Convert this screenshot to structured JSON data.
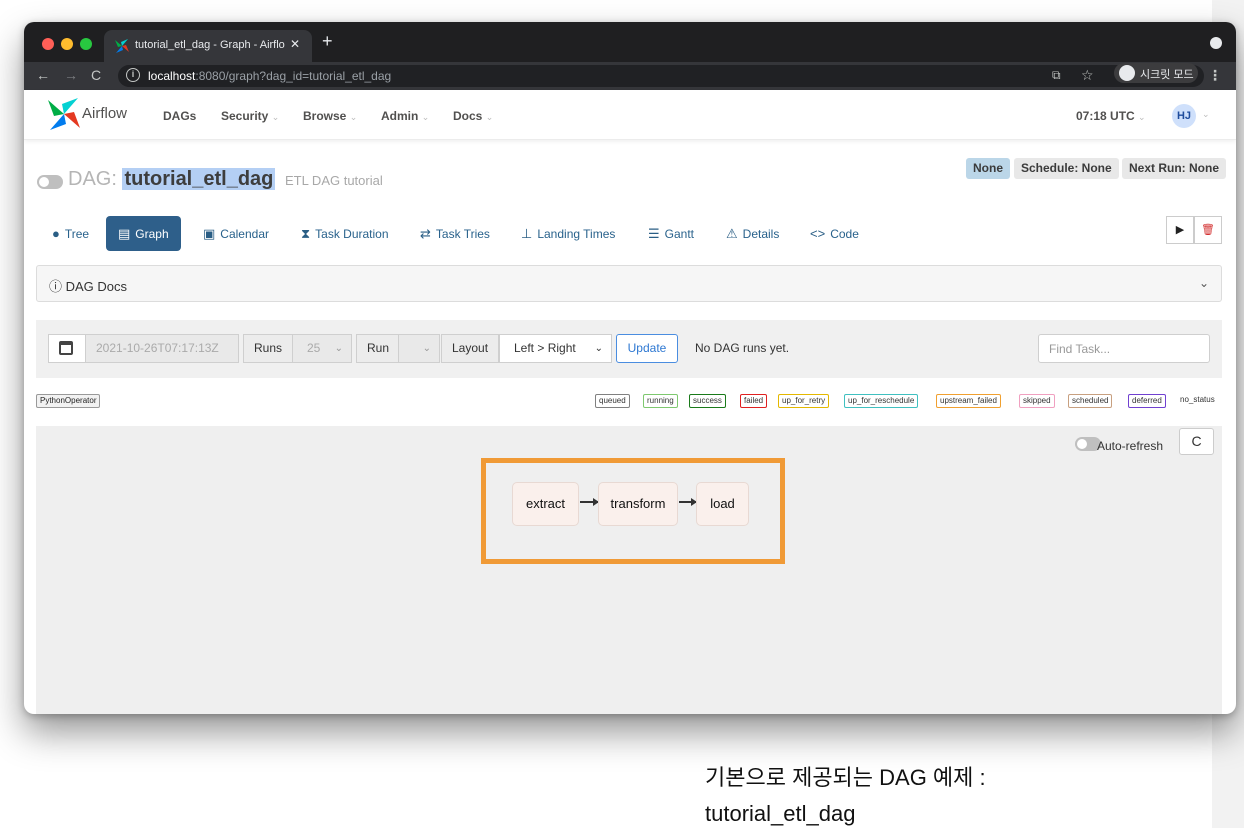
{
  "browser": {
    "tab_title": "tutorial_etl_dag - Graph - Airflo",
    "tab_close": "✕",
    "new_tab": "+",
    "url_host": "localhost",
    "url_rest": ":8080/graph?dag_id=tutorial_etl_dag",
    "incognito_label": "시크릿 모드"
  },
  "navbar": {
    "brand": "Airflow",
    "items": [
      {
        "label": "DAGs",
        "has_caret": false
      },
      {
        "label": "Security",
        "has_caret": true
      },
      {
        "label": "Browse",
        "has_caret": true
      },
      {
        "label": "Admin",
        "has_caret": true
      },
      {
        "label": "Docs",
        "has_caret": true
      }
    ],
    "caret": "⌄",
    "clock": "07:18 UTC",
    "avatar": "HJ"
  },
  "dag": {
    "prefix": "DAG:",
    "dag_id": "tutorial_etl_dag",
    "description": "ETL DAG tutorial",
    "badges": {
      "owner": "None",
      "schedule": "Schedule: None",
      "next_run": "Next Run: None"
    }
  },
  "views": [
    {
      "label": "Tree",
      "icon": "●"
    },
    {
      "label": "Graph",
      "icon": "▤"
    },
    {
      "label": "Calendar",
      "icon": "▣"
    },
    {
      "label": "Task Duration",
      "icon": "⧗"
    },
    {
      "label": "Task Tries",
      "icon": "⇄"
    },
    {
      "label": "Landing Times",
      "icon": "⊥"
    },
    {
      "label": "Gantt",
      "icon": "☰"
    },
    {
      "label": "Details",
      "icon": "⚠"
    },
    {
      "label": "Code",
      "icon": "<>"
    }
  ],
  "actions": {
    "trigger": "▶",
    "delete": "🗑"
  },
  "docs": {
    "title": "ⓘ DAG Docs",
    "chevron": "⌄"
  },
  "controls": {
    "base_date": "2021-10-26T07:17:13Z",
    "runs_label": "Runs",
    "runs_value": "25",
    "run_label": "Run",
    "run_value": "",
    "layout_label": "Layout",
    "layout_value": "Left > Right",
    "update": "Update",
    "no_runs": "No DAG runs yet.",
    "find_placeholder": "Find Task..."
  },
  "legend": {
    "operator": "PythonOperator",
    "statuses": [
      {
        "name": "queued",
        "color": "#808080"
      },
      {
        "name": "running",
        "color": "#7ec86f"
      },
      {
        "name": "success",
        "color": "#1a7a1a"
      },
      {
        "name": "failed",
        "color": "#e02020"
      },
      {
        "name": "up_for_retry",
        "color": "#e4b800"
      },
      {
        "name": "up_for_reschedule",
        "color": "#40c0c0"
      },
      {
        "name": "upstream_failed",
        "color": "#f0a030"
      },
      {
        "name": "skipped",
        "color": "#f0a0c0"
      },
      {
        "name": "scheduled",
        "color": "#c8a080"
      },
      {
        "name": "deferred",
        "color": "#7040d0"
      }
    ],
    "no_status": "no_status"
  },
  "graph": {
    "autorefresh": "Auto-refresh",
    "refresh": "C",
    "nodes": [
      "extract",
      "transform",
      "load"
    ]
  },
  "caption": {
    "line1": "기본으로 제공되는 DAG 예제 :",
    "line2": "tutorial_etl_dag"
  },
  "colors": {
    "highlight": "#f09a36",
    "active_tab": "#2e5f8a",
    "node_fill": "#faf0ec"
  }
}
